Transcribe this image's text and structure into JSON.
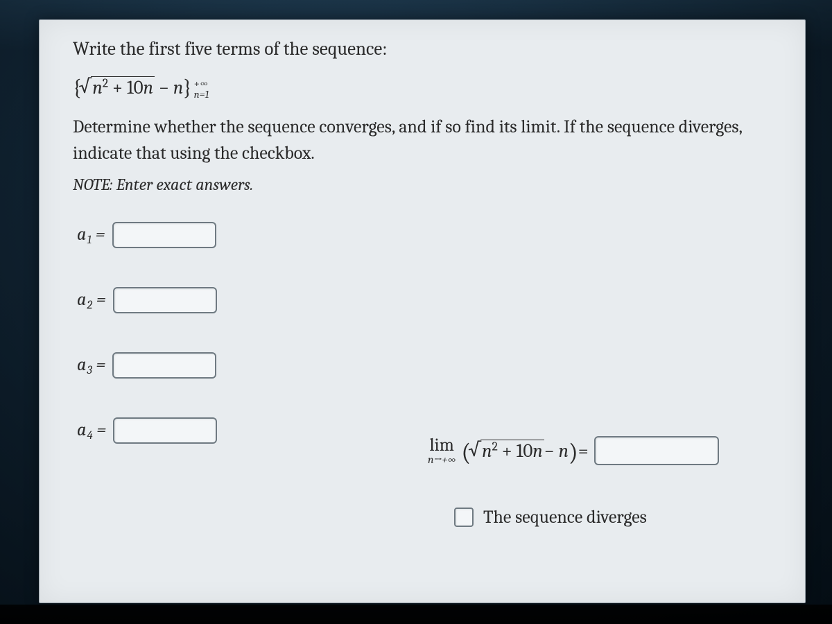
{
  "title": "Write the first five terms of the sequence:",
  "sequence": {
    "left_brace": "{",
    "right_brace": "}",
    "radicand_html": "n<sup class='exp'>2</sup> + 10n",
    "tail": " − n",
    "upper": "+∞",
    "lower": "n=1"
  },
  "body": "Determine whether the sequence converges, and if so find its limit. If the sequence diverges, indicate that using the checkbox.",
  "note_label": "NOTE:",
  "note_text": " Enter exact answers.",
  "terms": [
    {
      "label": "a",
      "sub": "1",
      "eq": " ="
    },
    {
      "label": "a",
      "sub": "2",
      "eq": " ="
    },
    {
      "label": "a",
      "sub": "3",
      "eq": " ="
    },
    {
      "label": "a",
      "sub": "4",
      "eq": " ="
    }
  ],
  "limit": {
    "lim": "lim",
    "under": "n→+∞",
    "eq": "="
  },
  "diverges_label": "The sequence diverges"
}
